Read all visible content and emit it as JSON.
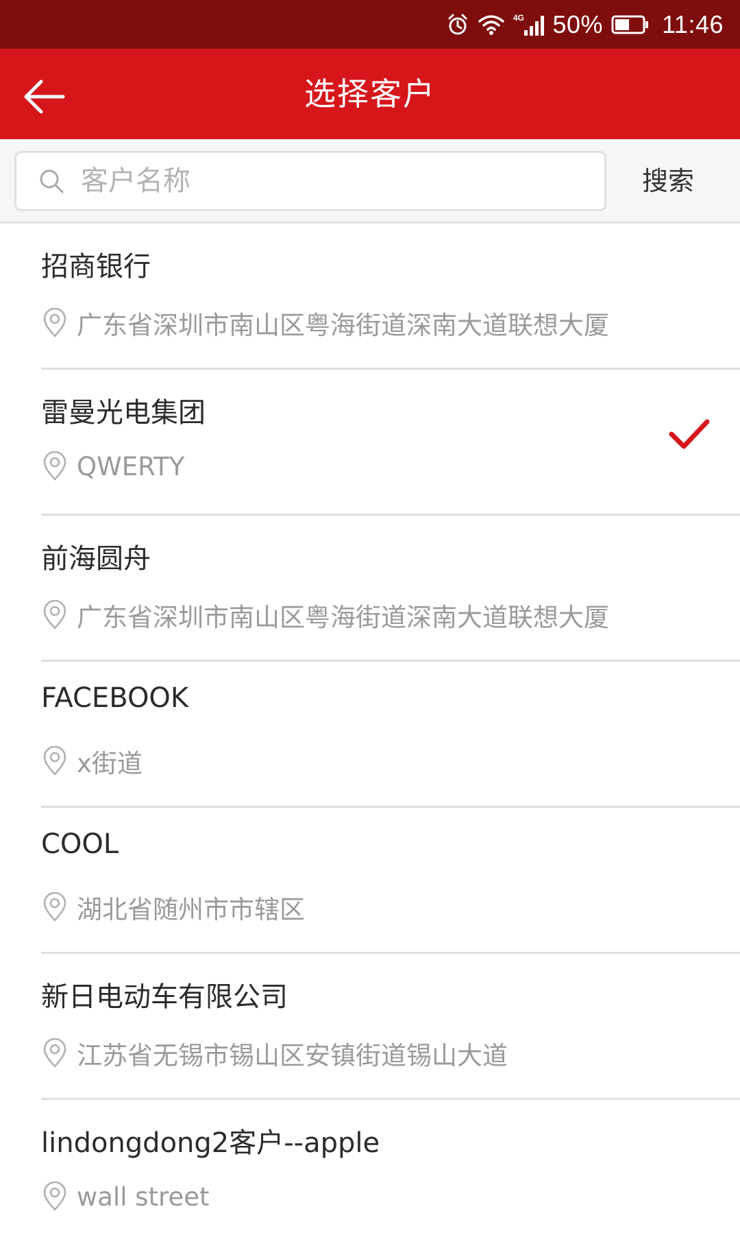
{
  "status_bar": {
    "network": "4G",
    "battery": "50%",
    "time": "11:46"
  },
  "header": {
    "title": "选择客户",
    "back_icon": "arrow-left-icon"
  },
  "search": {
    "placeholder": "客户名称",
    "value": "",
    "button_label": "搜索"
  },
  "colors": {
    "status_bar": "#7f0d0d",
    "app_bar": "#d6161b",
    "accent_check": "#d6161b"
  },
  "customers": [
    {
      "name": "招商银行",
      "address": "广东省深圳市南山区粤海街道深南大道联想大厦",
      "selected": false
    },
    {
      "name": "雷曼光电集团",
      "address": "QWERTY",
      "selected": true
    },
    {
      "name": "前海圆舟",
      "address": "广东省深圳市南山区粤海街道深南大道联想大厦",
      "selected": false
    },
    {
      "name": "FACEBOOK",
      "address": "x街道",
      "selected": false
    },
    {
      "name": "COOL",
      "address": "湖北省随州市市辖区",
      "selected": false
    },
    {
      "name": "新日电动车有限公司",
      "address": "江苏省无锡市锡山区安镇街道锡山大道",
      "selected": false
    },
    {
      "name": "lindongdong2客户--apple",
      "address": "wall street",
      "selected": false
    }
  ]
}
